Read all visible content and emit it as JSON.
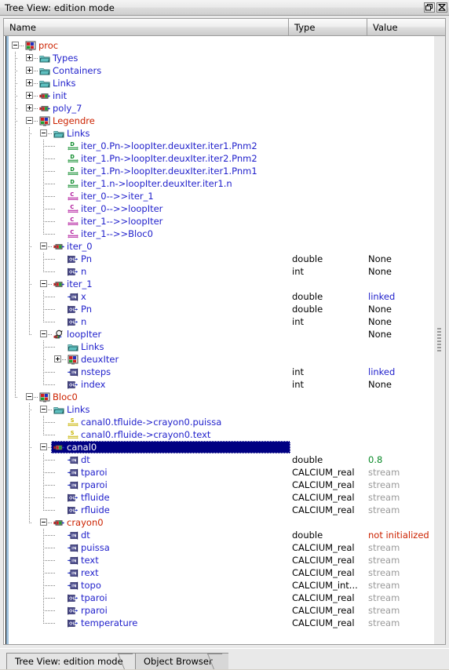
{
  "window": {
    "title": "Tree View: edition mode",
    "buttons": [
      {
        "name": "undock-button",
        "icon": "restore-icon"
      },
      {
        "name": "close-button",
        "icon": "close-icon"
      }
    ]
  },
  "columns": {
    "name": "Name",
    "type": "Type",
    "value": "Value"
  },
  "colors": {
    "node_red": "#cc2200",
    "node_blue": "#2222cc",
    "value_green": "#0a8a28",
    "value_red": "#cc2200",
    "value_gray": "#9a9a9a",
    "selection_bg": "#000082"
  },
  "tabs": [
    {
      "label": "Tree View: edition mode",
      "active": false
    },
    {
      "label": "Object Browser",
      "active": true
    }
  ],
  "tree": [
    {
      "indent": 0,
      "expander": "minus",
      "icon": "proc-icon",
      "label": "proc",
      "color": "red",
      "type": "",
      "value": "",
      "value_color": "",
      "selected": false
    },
    {
      "indent": 1,
      "expander": "plus",
      "icon": "folder-icon",
      "label": "Types",
      "color": "blue",
      "type": "",
      "value": "",
      "value_color": "",
      "selected": false
    },
    {
      "indent": 1,
      "expander": "plus",
      "icon": "folder-icon",
      "label": "Containers",
      "color": "blue",
      "type": "",
      "value": "",
      "value_color": "",
      "selected": false
    },
    {
      "indent": 1,
      "expander": "plus",
      "icon": "folder-icon",
      "label": "Links",
      "color": "blue",
      "type": "",
      "value": "",
      "value_color": "",
      "selected": false
    },
    {
      "indent": 1,
      "expander": "plus",
      "icon": "service-icon",
      "label": "init",
      "color": "blue",
      "type": "",
      "value": "",
      "value_color": "",
      "selected": false
    },
    {
      "indent": 1,
      "expander": "plus",
      "icon": "service-icon",
      "label": "poly_7",
      "color": "blue",
      "type": "",
      "value": "",
      "value_color": "",
      "selected": false
    },
    {
      "indent": 1,
      "expander": "minus",
      "icon": "proc-icon",
      "label": "Legendre",
      "color": "red",
      "type": "",
      "value": "",
      "value_color": "",
      "selected": false
    },
    {
      "indent": 2,
      "expander": "minus",
      "icon": "folder-icon",
      "label": "Links",
      "color": "blue",
      "type": "",
      "value": "",
      "value_color": "",
      "selected": false
    },
    {
      "indent": 3,
      "expander": "none",
      "icon": "datalink-icon",
      "label": "iter_0.Pn->loopIter.deuxIter.iter1.Pnm2",
      "color": "blue",
      "type": "",
      "value": "",
      "value_color": "",
      "selected": false
    },
    {
      "indent": 3,
      "expander": "none",
      "icon": "datalink-icon",
      "label": "iter_1.Pn->loopIter.deuxIter.iter2.Pnm2",
      "color": "blue",
      "type": "",
      "value": "",
      "value_color": "",
      "selected": false
    },
    {
      "indent": 3,
      "expander": "none",
      "icon": "datalink-icon",
      "label": "iter_1.Pn->loopIter.deuxIter.iter1.Pnm1",
      "color": "blue",
      "type": "",
      "value": "",
      "value_color": "",
      "selected": false
    },
    {
      "indent": 3,
      "expander": "none",
      "icon": "datalink-icon",
      "label": "iter_1.n->loopIter.deuxIter.iter1.n",
      "color": "blue",
      "type": "",
      "value": "",
      "value_color": "",
      "selected": false
    },
    {
      "indent": 3,
      "expander": "none",
      "icon": "controllink-icon",
      "label": "iter_0-->>iter_1",
      "color": "blue",
      "type": "",
      "value": "",
      "value_color": "",
      "selected": false
    },
    {
      "indent": 3,
      "expander": "none",
      "icon": "controllink-icon",
      "label": "iter_0-->>loopIter",
      "color": "blue",
      "type": "",
      "value": "",
      "value_color": "",
      "selected": false
    },
    {
      "indent": 3,
      "expander": "none",
      "icon": "controllink-icon",
      "label": "iter_1-->>loopIter",
      "color": "blue",
      "type": "",
      "value": "",
      "value_color": "",
      "selected": false
    },
    {
      "indent": 3,
      "expander": "none",
      "icon": "controllink-icon",
      "label": "iter_1-->>Bloc0",
      "color": "blue",
      "type": "",
      "value": "",
      "value_color": "",
      "selected": false
    },
    {
      "indent": 2,
      "expander": "minus",
      "icon": "service-icon",
      "label": "iter_0",
      "color": "blue",
      "type": "",
      "value": "",
      "value_color": "",
      "selected": false
    },
    {
      "indent": 3,
      "expander": "none",
      "icon": "outport-icon",
      "label": "Pn",
      "color": "blue",
      "type": "double",
      "value": "None",
      "value_color": "black",
      "selected": false
    },
    {
      "indent": 3,
      "expander": "none",
      "icon": "outport-icon",
      "label": "n",
      "color": "blue",
      "type": "int",
      "value": "None",
      "value_color": "black",
      "selected": false
    },
    {
      "indent": 2,
      "expander": "minus",
      "icon": "service-icon",
      "label": "iter_1",
      "color": "blue",
      "type": "",
      "value": "",
      "value_color": "",
      "selected": false
    },
    {
      "indent": 3,
      "expander": "none",
      "icon": "inport-icon",
      "label": "x",
      "color": "blue",
      "type": "double",
      "value": "linked",
      "value_color": "linked",
      "selected": false
    },
    {
      "indent": 3,
      "expander": "none",
      "icon": "outport-icon",
      "label": "Pn",
      "color": "blue",
      "type": "double",
      "value": "None",
      "value_color": "black",
      "selected": false
    },
    {
      "indent": 3,
      "expander": "none",
      "icon": "outport-icon",
      "label": "n",
      "color": "blue",
      "type": "int",
      "value": "None",
      "value_color": "black",
      "selected": false
    },
    {
      "indent": 2,
      "expander": "minus",
      "icon": "loop-icon",
      "label": "loopIter",
      "color": "blue",
      "type": "",
      "value": "None",
      "value_color": "black",
      "selected": false
    },
    {
      "indent": 3,
      "expander": "none",
      "icon": "folder-icon",
      "label": "Links",
      "color": "blue",
      "type": "",
      "value": "",
      "value_color": "",
      "selected": false
    },
    {
      "indent": 3,
      "expander": "plus",
      "icon": "proc-icon",
      "label": "deuxIter",
      "color": "blue",
      "type": "",
      "value": "",
      "value_color": "",
      "selected": false
    },
    {
      "indent": 3,
      "expander": "none",
      "icon": "inport-icon",
      "label": "nsteps",
      "color": "blue",
      "type": "int",
      "value": "linked",
      "value_color": "linked",
      "selected": false
    },
    {
      "indent": 3,
      "expander": "none",
      "icon": "outport-icon",
      "label": "index",
      "color": "blue",
      "type": "int",
      "value": "None",
      "value_color": "black",
      "selected": false
    },
    {
      "indent": 1,
      "expander": "minus",
      "icon": "proc-icon",
      "label": "Bloc0",
      "color": "red",
      "type": "",
      "value": "",
      "value_color": "",
      "selected": false
    },
    {
      "indent": 2,
      "expander": "minus",
      "icon": "folder-icon",
      "label": "Links",
      "color": "blue",
      "type": "",
      "value": "",
      "value_color": "",
      "selected": false
    },
    {
      "indent": 3,
      "expander": "none",
      "icon": "streamlink-icon",
      "label": "canal0.tfluide->crayon0.puissa",
      "color": "blue",
      "type": "",
      "value": "",
      "value_color": "",
      "selected": false
    },
    {
      "indent": 3,
      "expander": "none",
      "icon": "streamlink-icon",
      "label": "canal0.rfluide->crayon0.text",
      "color": "blue",
      "type": "",
      "value": "",
      "value_color": "",
      "selected": false
    },
    {
      "indent": 2,
      "expander": "minus",
      "icon": "service-icon",
      "label": "canal0",
      "color": "blue",
      "type": "",
      "value": "",
      "value_color": "",
      "selected": true
    },
    {
      "indent": 3,
      "expander": "none",
      "icon": "inport-icon",
      "label": "dt",
      "color": "blue",
      "type": "double",
      "value": "0.8",
      "value_color": "green",
      "selected": false
    },
    {
      "indent": 3,
      "expander": "none",
      "icon": "inport-icon",
      "label": "tparoi",
      "color": "blue",
      "type": "CALCIUM_real",
      "value": "stream",
      "value_color": "gray",
      "selected": false
    },
    {
      "indent": 3,
      "expander": "none",
      "icon": "inport-icon",
      "label": "rparoi",
      "color": "blue",
      "type": "CALCIUM_real",
      "value": "stream",
      "value_color": "gray",
      "selected": false
    },
    {
      "indent": 3,
      "expander": "none",
      "icon": "outport-icon",
      "label": "tfluide",
      "color": "blue",
      "type": "CALCIUM_real",
      "value": "stream",
      "value_color": "gray",
      "selected": false
    },
    {
      "indent": 3,
      "expander": "none",
      "icon": "outport-icon",
      "label": "rfluide",
      "color": "blue",
      "type": "CALCIUM_real",
      "value": "stream",
      "value_color": "gray",
      "selected": false
    },
    {
      "indent": 2,
      "expander": "minus",
      "icon": "service-icon",
      "label": "crayon0",
      "color": "red",
      "type": "",
      "value": "",
      "value_color": "",
      "selected": false
    },
    {
      "indent": 3,
      "expander": "none",
      "icon": "inport-icon",
      "label": "dt",
      "color": "blue",
      "type": "double",
      "value": "not initialized",
      "value_color": "red",
      "selected": false
    },
    {
      "indent": 3,
      "expander": "none",
      "icon": "inport-icon",
      "label": "puissa",
      "color": "blue",
      "type": "CALCIUM_real",
      "value": "stream",
      "value_color": "gray",
      "selected": false
    },
    {
      "indent": 3,
      "expander": "none",
      "icon": "inport-icon",
      "label": "text",
      "color": "blue",
      "type": "CALCIUM_real",
      "value": "stream",
      "value_color": "gray",
      "selected": false
    },
    {
      "indent": 3,
      "expander": "none",
      "icon": "inport-icon",
      "label": "rext",
      "color": "blue",
      "type": "CALCIUM_real",
      "value": "stream",
      "value_color": "gray",
      "selected": false
    },
    {
      "indent": 3,
      "expander": "none",
      "icon": "inport-icon",
      "label": "topo",
      "color": "blue",
      "type": "CALCIUM_int...",
      "value": "stream",
      "value_color": "gray",
      "selected": false
    },
    {
      "indent": 3,
      "expander": "none",
      "icon": "outport-icon",
      "label": "tparoi",
      "color": "blue",
      "type": "CALCIUM_real",
      "value": "stream",
      "value_color": "gray",
      "selected": false
    },
    {
      "indent": 3,
      "expander": "none",
      "icon": "outport-icon",
      "label": "rparoi",
      "color": "blue",
      "type": "CALCIUM_real",
      "value": "stream",
      "value_color": "gray",
      "selected": false
    },
    {
      "indent": 3,
      "expander": "none",
      "icon": "outport-icon",
      "label": "temperature",
      "color": "blue",
      "type": "CALCIUM_real",
      "value": "stream",
      "value_color": "gray",
      "selected": false
    }
  ]
}
